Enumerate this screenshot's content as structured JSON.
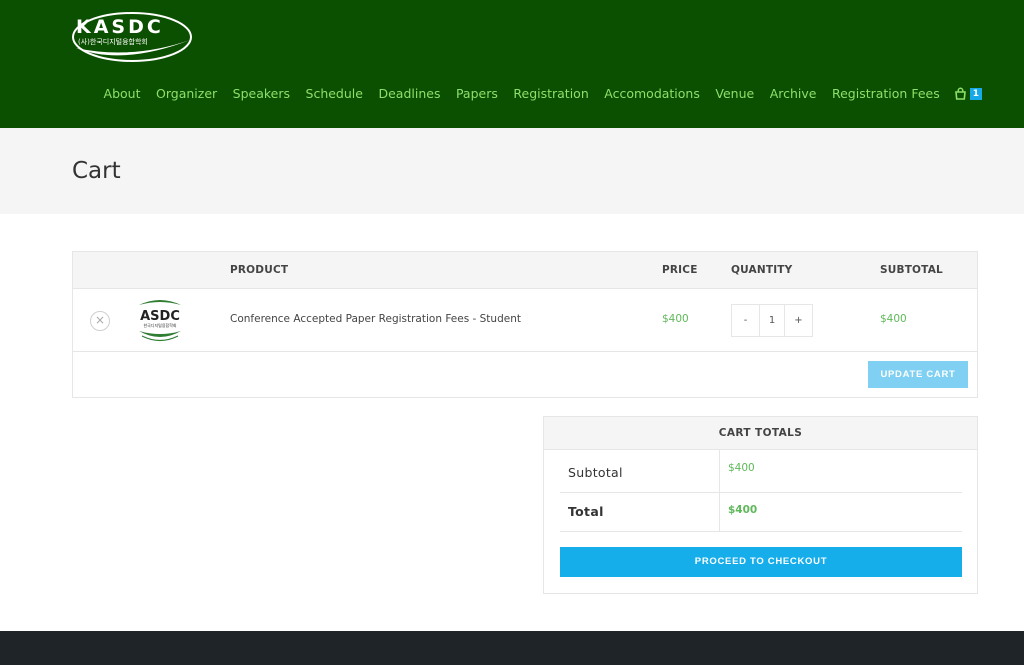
{
  "header": {
    "logo_text": "KASDC",
    "logo_subtext": "(사)한국디지털융합학회",
    "nav": [
      {
        "label": "About"
      },
      {
        "label": "Organizer"
      },
      {
        "label": "Speakers"
      },
      {
        "label": "Schedule"
      },
      {
        "label": "Deadlines"
      },
      {
        "label": "Papers"
      },
      {
        "label": "Registration"
      },
      {
        "label": "Accomodations"
      },
      {
        "label": "Venue"
      },
      {
        "label": "Archive"
      },
      {
        "label": "Registration Fees"
      }
    ],
    "cart_count": "1",
    "cart_icon": "shopping-bag-icon"
  },
  "page": {
    "title": "Cart"
  },
  "cart_table": {
    "headers": {
      "product": "PRODUCT",
      "price": "PRICE",
      "quantity": "QUANTITY",
      "subtotal": "SUBTOTAL"
    },
    "items": [
      {
        "thumbnail_text": "ASDC",
        "thumbnail_subtext": "한국디지털융합학회",
        "product": "Conference Accepted Paper Registration Fees - Student",
        "price": "$400",
        "quantity": "1",
        "subtotal": "$400"
      }
    ],
    "remove_symbol": "×",
    "qty_minus": "-",
    "qty_plus": "+",
    "update_label": "UPDATE CART"
  },
  "cart_totals": {
    "title": "CART TOTALS",
    "subtotal_label": "Subtotal",
    "subtotal_value": "$400",
    "total_label": "Total",
    "total_value": "$400",
    "checkout_label": "PROCEED TO CHECKOUT"
  },
  "colors": {
    "header_bg": "#0b4f00",
    "nav_text": "#8ee06a",
    "accent_blue": "#15aeea",
    "price_green": "#5fb85a"
  }
}
